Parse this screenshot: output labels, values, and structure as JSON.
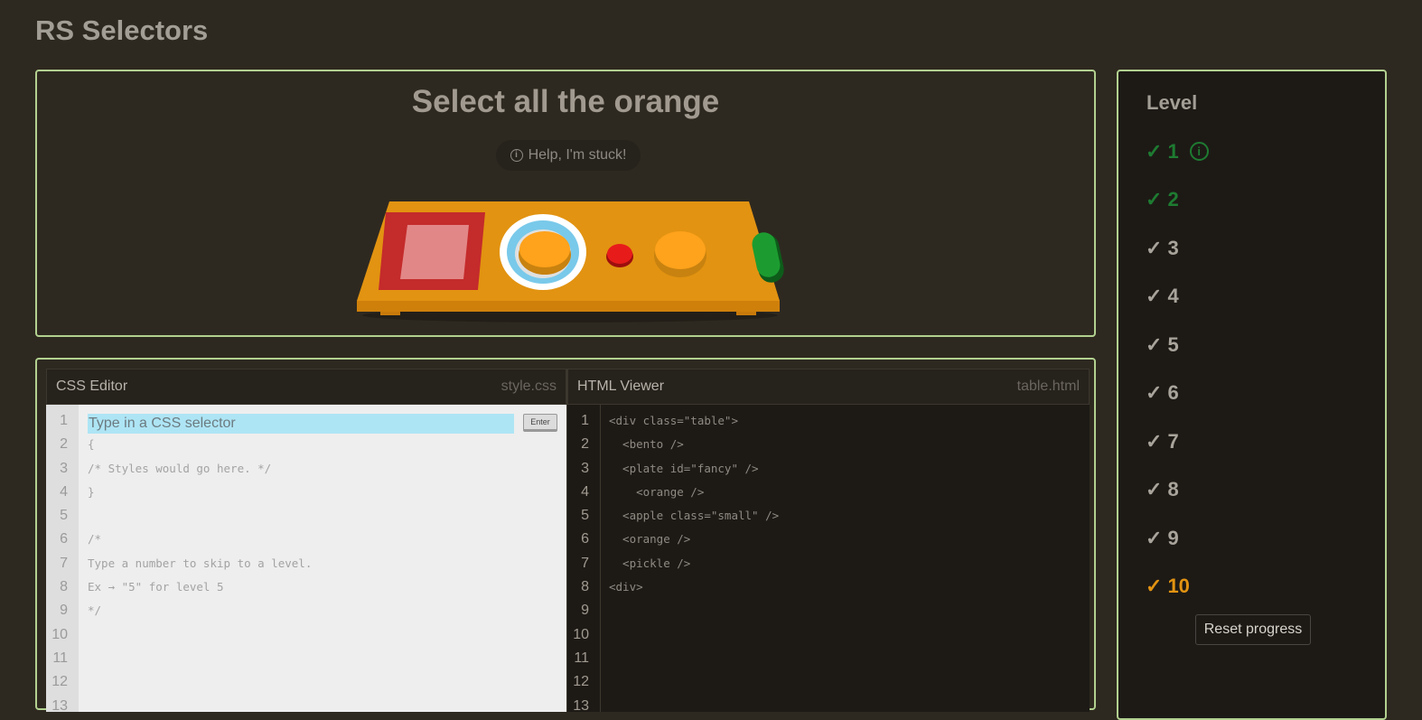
{
  "app": {
    "title": "RS Selectors"
  },
  "game": {
    "instruction": "Select all the orange",
    "help_label": "Help, I'm stuck!",
    "help_icon": "info-icon"
  },
  "editor": {
    "css": {
      "title": "CSS Editor",
      "filename": "style.css",
      "placeholder": "Type in a CSS selector",
      "enter_label": "Enter",
      "line_numbers": [
        "1",
        "2",
        "3",
        "4",
        "5",
        "6",
        "7",
        "8",
        "9",
        "10",
        "11",
        "12",
        "13"
      ],
      "lines": [
        "",
        "{",
        "/* Styles would go here. */",
        "}",
        "",
        "/*",
        "Type a number to skip to a level.",
        "Ex → \"5\" for level 5",
        "*/",
        "",
        "",
        "",
        ""
      ]
    },
    "html": {
      "title": "HTML Viewer",
      "filename": "table.html",
      "line_numbers": [
        "1",
        "2",
        "3",
        "4",
        "5",
        "6",
        "7",
        "8",
        "9",
        "10",
        "11",
        "12",
        "13"
      ],
      "lines": [
        "<div class=\"table\">",
        "  <bento />",
        "  <plate id=\"fancy\" />",
        "    <orange />",
        "  <apple class=\"small\" />",
        "  <orange />",
        "  <pickle />",
        "<div>",
        "",
        "",
        "",
        "",
        ""
      ]
    }
  },
  "sidebar": {
    "heading": "Level",
    "check_glyph": "✓",
    "levels": [
      {
        "number": "1",
        "state": "done",
        "has_info": true
      },
      {
        "number": "2",
        "state": "done",
        "has_info": false
      },
      {
        "number": "3",
        "state": "normal",
        "has_info": false
      },
      {
        "number": "4",
        "state": "normal",
        "has_info": false
      },
      {
        "number": "5",
        "state": "normal",
        "has_info": false
      },
      {
        "number": "6",
        "state": "normal",
        "has_info": false
      },
      {
        "number": "7",
        "state": "normal",
        "has_info": false
      },
      {
        "number": "8",
        "state": "normal",
        "has_info": false
      },
      {
        "number": "9",
        "state": "normal",
        "has_info": false
      },
      {
        "number": "10",
        "state": "current",
        "has_info": false
      }
    ],
    "reset_label": "Reset progress"
  },
  "colors": {
    "background": "#2e2920",
    "panel_border": "#b2d190",
    "done_level": "#1e7b31",
    "current_level": "#e29311",
    "selector_highlight": "#aee5f5"
  }
}
